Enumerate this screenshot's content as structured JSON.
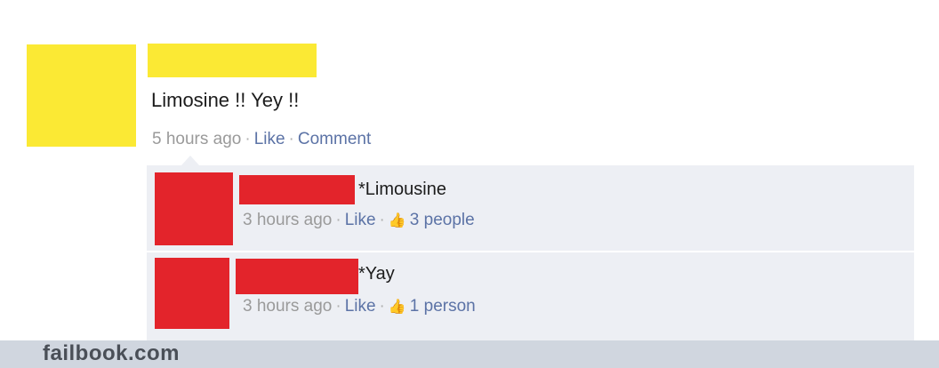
{
  "post": {
    "text": "Limosine !! Yey !!",
    "time": "5 hours ago",
    "like_label": "Like",
    "comment_label": "Comment"
  },
  "comments": [
    {
      "text": "*Limousine",
      "time": "3 hours ago",
      "like_label": "Like",
      "likes": "3 people"
    },
    {
      "text": "*Yay",
      "time": "3 hours ago",
      "like_label": "Like",
      "likes": "1 person"
    }
  ],
  "footer": {
    "watermark": "failbook.com"
  },
  "colors": {
    "redaction_post": "#fbe934",
    "redaction_comments": "#e3242b",
    "link": "#5c73a6",
    "comment_bg": "#edeff4"
  },
  "icons": {
    "thumb": "thumbs-up-icon"
  }
}
